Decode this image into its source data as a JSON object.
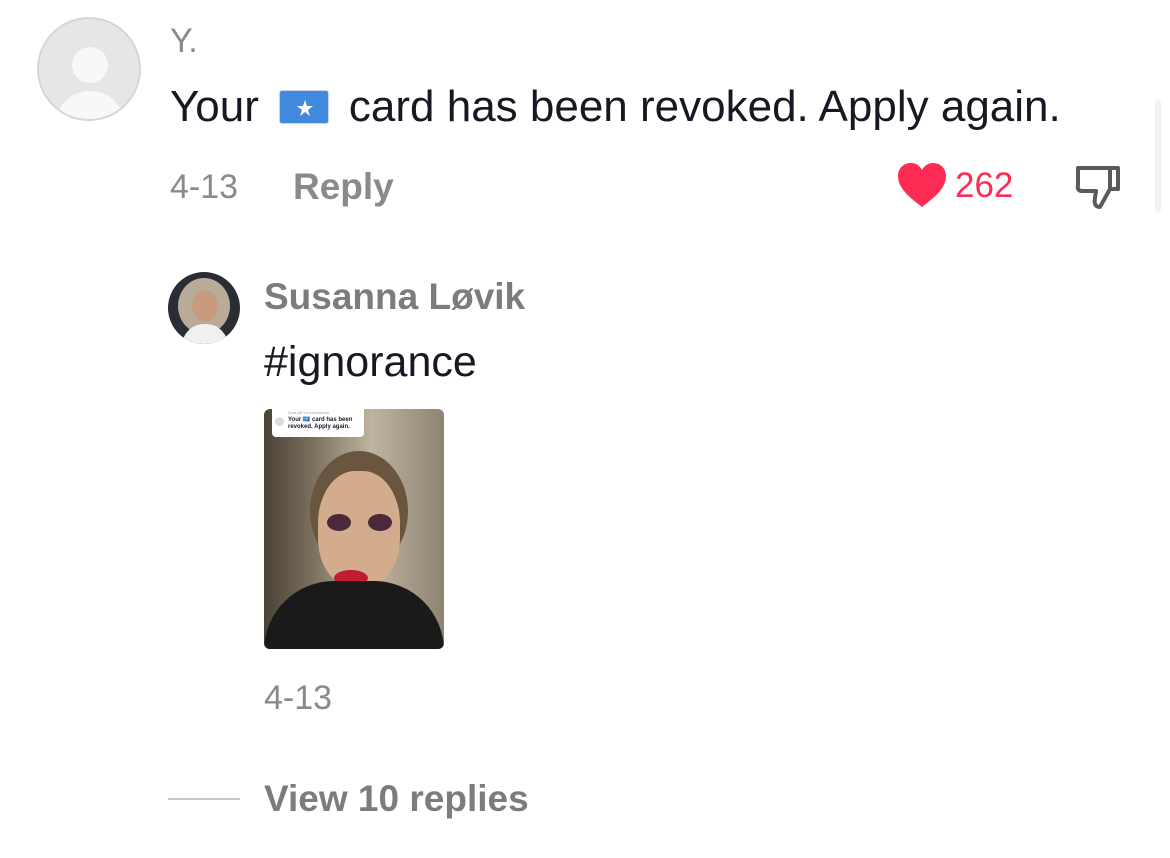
{
  "comment": {
    "author": "Y.",
    "text_before_flag": "Your",
    "flag_icon": "somalia-flag-icon",
    "text_after_flag": "card has been revoked. Apply again.",
    "date": "4-13",
    "reply_label": "Reply",
    "like_count": "262",
    "like_color": "#fe2c55"
  },
  "reply": {
    "author": "Susanna Løvik",
    "text": "#ignorance",
    "thumbnail": {
      "bubble_header": "Svar på Y.s kommentar",
      "bubble_text": "Your 🇸🇴 card has been revoked. Apply again."
    },
    "date": "4-13"
  },
  "view_replies_label": "View 10 replies"
}
